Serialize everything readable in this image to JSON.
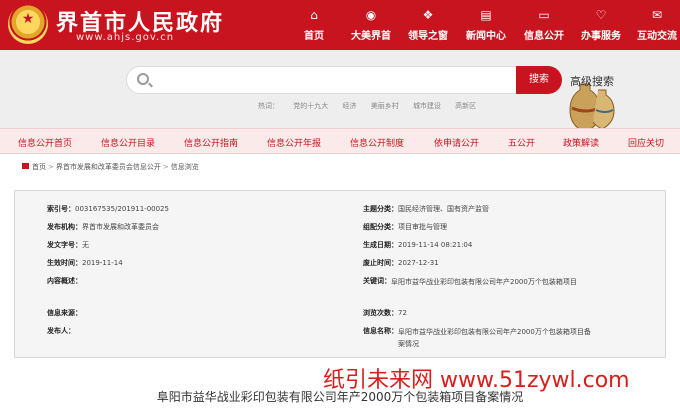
{
  "header": {
    "title": "界首市人民政府",
    "url": "www.ahjs.gov.cn",
    "nav": [
      {
        "icon": "home-icon",
        "glyph": "⌂",
        "label": "首页"
      },
      {
        "icon": "camera-icon",
        "glyph": "◉",
        "label": "大美界首"
      },
      {
        "icon": "leaders-icon",
        "glyph": "❖",
        "label": "领导之窗"
      },
      {
        "icon": "news-icon",
        "glyph": "▤",
        "label": "新闻中心"
      },
      {
        "icon": "folder-icon",
        "glyph": "▭",
        "label": "信息公开"
      },
      {
        "icon": "heart-icon",
        "glyph": "♡",
        "label": "办事服务"
      },
      {
        "icon": "message-icon",
        "glyph": "✉",
        "label": "互动交流"
      }
    ]
  },
  "search": {
    "placeholder": "",
    "button_label": "搜索",
    "advanced_label": "高级搜索",
    "hot_label": "热词：",
    "hot_words": [
      "党的十九大",
      "经济",
      "美丽乡村",
      "城市建设",
      "高新区"
    ]
  },
  "info_nav": [
    "信息公开首页",
    "信息公开目录",
    "信息公开指南",
    "信息公开年报",
    "信息公开制度",
    "依申请公开",
    "五公开",
    "政策解读",
    "回应关切"
  ],
  "breadcrumb": [
    "首页",
    "界首市发展和改革委员会信息公开",
    "信息浏览"
  ],
  "meta": {
    "index_no": {
      "label": "索引号：",
      "value": "003167535/201911-00025"
    },
    "subject": {
      "label": "主题分类：",
      "value": "国民经济管理、国有资产监管"
    },
    "publisher_org": {
      "label": "发布机构：",
      "value": "界首市发展和改革委员会"
    },
    "genre": {
      "label": "组配分类：",
      "value": "项目审批与管理"
    },
    "doc_no": {
      "label": "发文字号：",
      "value": "无"
    },
    "created": {
      "label": "生成日期：",
      "value": "2019-11-14 08:21:04"
    },
    "effective": {
      "label": "生效时间：",
      "value": "2019-11-14"
    },
    "expiry": {
      "label": "废止时间：",
      "value": "2027-12-31"
    },
    "summary": {
      "label": "内容概述：",
      "value": ""
    },
    "keywords": {
      "label": "关键词：",
      "value": "阜阳市益华战业彩印包装有限公司年产2000万个包装箱项目"
    },
    "source": {
      "label": "信息来源：",
      "value": ""
    },
    "views": {
      "label": "浏览次数：",
      "value": "72"
    },
    "publisher": {
      "label": "发布人：",
      "value": ""
    },
    "info_name": {
      "label": "信息名称：",
      "value": "阜阳市益华战业彩印包装有限公司年产2000万个包装箱项目备案情况"
    }
  },
  "watermark": "纸引未来网 www.51zywl.com",
  "doc_title": "阜阳市益华战业彩印包装有限公司年产2000万个包装箱项目备案情况",
  "colors": {
    "brand": "#c8141e",
    "nav_bg": "#fbeaea",
    "band_bg": "#eeeeee"
  }
}
